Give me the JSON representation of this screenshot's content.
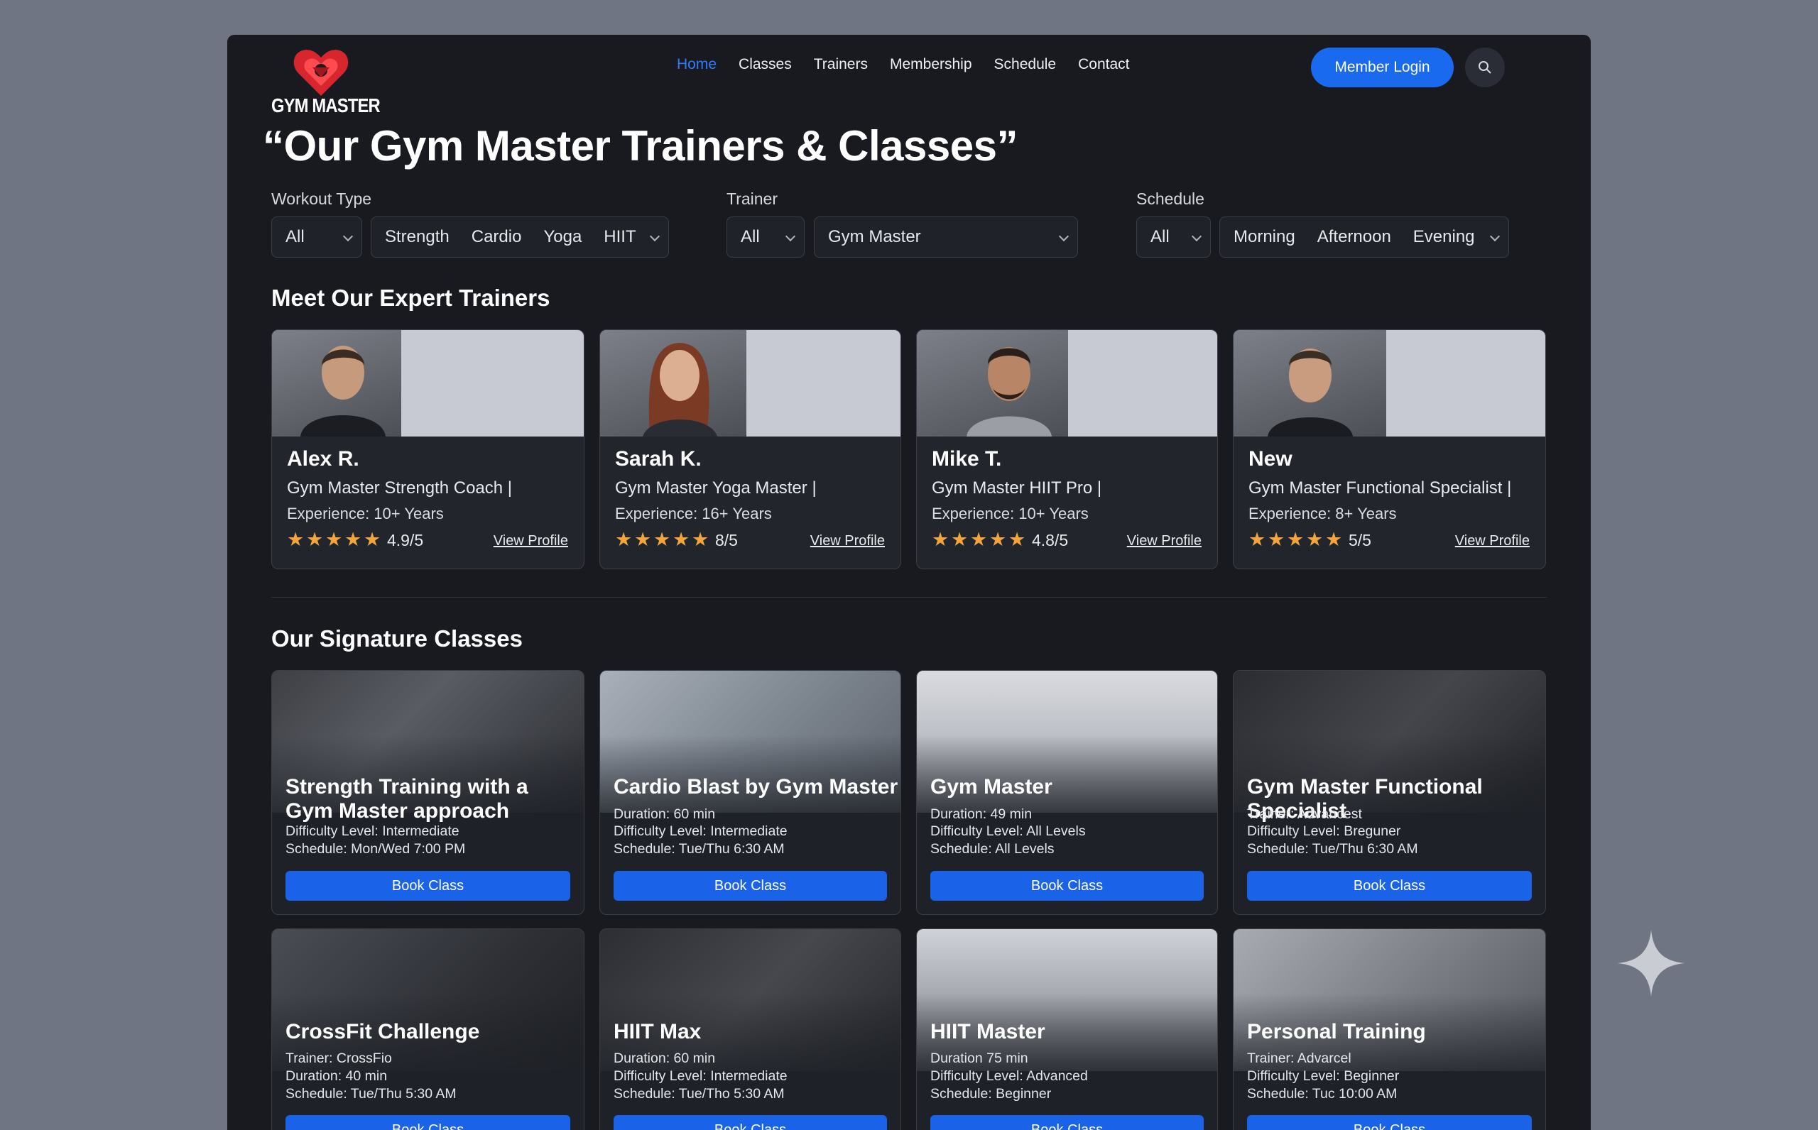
{
  "brand": {
    "name": "GYM MASTER"
  },
  "nav": {
    "items": [
      "Home",
      "Classes",
      "Trainers",
      "Membership",
      "Schedule",
      "Contact"
    ],
    "active": "Home"
  },
  "header": {
    "login_label": "Member Login"
  },
  "page": {
    "title": "“Our Gym Master Trainers & Classes”"
  },
  "filters": {
    "workout": {
      "label": "Workout Type",
      "selected": "All",
      "options": [
        "Strength",
        "Cardio",
        "Yoga",
        "HIIT"
      ]
    },
    "trainer": {
      "label": "Trainer",
      "selected": "All",
      "value": "Gym Master"
    },
    "schedule": {
      "label": "Schedule",
      "selected": "All",
      "options": [
        "Morning",
        "Afternoon",
        "Evening"
      ]
    }
  },
  "trainers": {
    "title": "Meet Our Expert Trainers",
    "items": [
      {
        "name": "Alex R.",
        "role": "Gym Master Strength Coach |",
        "experience": "Experience: 10+ Years",
        "rating": "4.9/5",
        "stars": 5,
        "link": "View Profile"
      },
      {
        "name": "Sarah K.",
        "role": "Gym Master Yoga Master |",
        "experience": "Experience: 16+ Years",
        "rating": "8/5",
        "stars": 5,
        "link": "View Profile"
      },
      {
        "name": "Mike T.",
        "role": "Gym Master HIIT Pro |",
        "experience": "Experience: 10+ Years",
        "rating": "4.8/5",
        "stars": 5,
        "link": "View Profile"
      },
      {
        "name": "New",
        "role": "Gym Master Functional Specialist |",
        "experience": "Experience: 8+ Years",
        "rating": "5/5",
        "stars": 5,
        "link": "View Profile"
      }
    ]
  },
  "classes": {
    "title": "Our Signature Classes",
    "book_label": "Book Class",
    "items": [
      {
        "title": "Strength Training with a Gym Master approach",
        "lines": [
          "Difficulty Level: Intermediate",
          "Schedule: Mon/Wed 7:00 PM"
        ]
      },
      {
        "title": "Cardio Blast by Gym Master",
        "lines": [
          "Duration: 60 min",
          "Difficulty Level: Intermediate",
          "Schedule: Tue/Thu 6:30 AM"
        ]
      },
      {
        "title": "Gym Master",
        "lines": [
          "Duration: 49 min",
          "Difficulty Level: All Levels",
          "Schedule: All Levels"
        ]
      },
      {
        "title": "Gym Master Functional Specialist",
        "lines": [
          "Trainer: Advancest",
          "Difficulty Level: Breguner",
          "Schedule: Tue/Thu 6:30 AM"
        ]
      },
      {
        "title": "CrossFit Challenge",
        "lines": [
          "Trainer: CrossFio",
          "Duration: 40 min",
          "Schedule: Tue/Thu 5:30 AM"
        ]
      },
      {
        "title": "HIIT Max",
        "lines": [
          "Duration: 60 min",
          "Difficulty Level: Intermediate",
          "Schedule: Tue/Tho 5:30 AM"
        ]
      },
      {
        "title": "HIIT Master",
        "lines": [
          "Duration 75 min",
          "Difficulty Level: Advanced",
          "Schedule: Beginner"
        ]
      },
      {
        "title": "Personal Training",
        "lines": [
          "Trainer: Advarcel",
          "Difficulty Level: Beginner",
          "Schedule: Tuc 10:00 AM"
        ]
      }
    ]
  },
  "colors": {
    "accent": "#1a6af0",
    "active_nav": "#2f7dff",
    "star": "#f3a53a",
    "background": "#181a20"
  }
}
